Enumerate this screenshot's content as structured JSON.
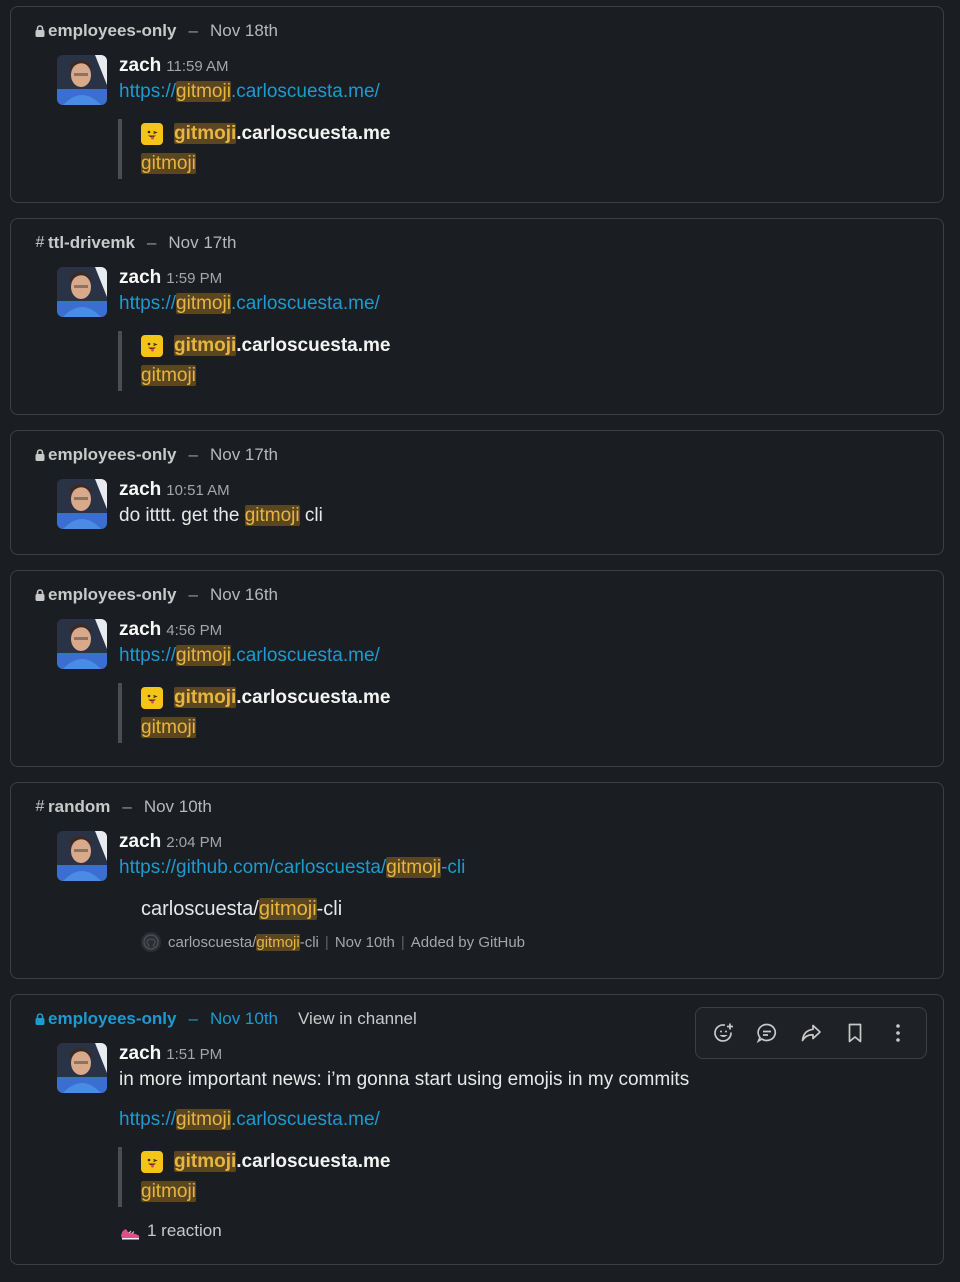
{
  "author": "zach",
  "results": [
    {
      "channel_icon": "lock-icon",
      "channel": "employees-only",
      "date": "Nov 18th",
      "time": "11:59 AM",
      "lines": [],
      "link": {
        "pre": "https://",
        "hl": "gitmoji",
        "post": ".carloscuesta.me/"
      },
      "unfurl": {
        "type": "site",
        "title_hl": "gitmoji",
        "title_rest": ".carloscuesta.me",
        "desc_hl": "gitmoji"
      }
    },
    {
      "channel_icon": "hash-icon",
      "channel": "ttl-drivemk",
      "date": "Nov 17th",
      "time": "1:59 PM",
      "lines": [],
      "link": {
        "pre": "https://",
        "hl": "gitmoji",
        "post": ".carloscuesta.me/"
      },
      "unfurl": {
        "type": "site",
        "title_hl": "gitmoji",
        "title_rest": ".carloscuesta.me",
        "desc_hl": "gitmoji"
      }
    },
    {
      "channel_icon": "lock-icon",
      "channel": "employees-only",
      "date": "Nov 17th",
      "time": "10:51 AM",
      "lines": [
        {
          "pre": "do itttt. get the ",
          "hl": "gitmoji",
          "post": " cli"
        }
      ]
    },
    {
      "channel_icon": "lock-icon",
      "channel": "employees-only",
      "date": "Nov 16th",
      "time": "4:56 PM",
      "lines": [],
      "link": {
        "pre": "https://",
        "hl": "gitmoji",
        "post": ".carloscuesta.me/"
      },
      "unfurl": {
        "type": "site",
        "title_hl": "gitmoji",
        "title_rest": ".carloscuesta.me",
        "desc_hl": "gitmoji"
      }
    },
    {
      "channel_icon": "hash-icon",
      "channel": "random",
      "date": "Nov 10th",
      "time": "2:04 PM",
      "lines": [],
      "link": {
        "pre": "https://github.com/carloscuesta/",
        "hl": "gitmoji",
        "post": "-cli"
      },
      "unfurl": {
        "type": "github",
        "title_pre": "carloscuesta/",
        "title_hl": "gitmoji",
        "title_post": "-cli",
        "footer_repo_pre": "carloscuesta/",
        "footer_repo_hl": "gitmoji",
        "footer_repo_post": "-cli",
        "footer_date": "Nov 10th",
        "footer_added": "Added by GitHub"
      }
    },
    {
      "channel_icon": "lock-icon",
      "channel": "employees-only",
      "date": "Nov 10th",
      "time": "1:51 PM",
      "view_in_channel": "View in channel",
      "lines": [
        {
          "pre": "in more important news: i’m gonna start using emojis in my commits",
          "hl": "",
          "post": ""
        }
      ],
      "link": {
        "pre": "https://",
        "hl": "gitmoji",
        "post": ".carloscuesta.me/"
      },
      "unfurl": {
        "type": "site",
        "title_hl": "gitmoji",
        "title_rest": ".carloscuesta.me",
        "desc_hl": "gitmoji"
      },
      "reaction": "1 reaction",
      "toolbar": [
        "add-reaction-icon",
        "reply-in-thread-icon",
        "share-icon",
        "bookmark-icon",
        "more-actions-icon"
      ]
    }
  ]
}
